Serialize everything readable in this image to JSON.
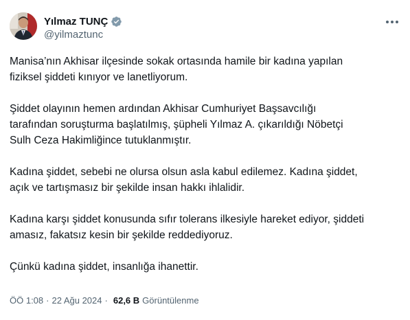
{
  "author": {
    "display_name": "Yılmaz TUNÇ",
    "handle": "@yilmaztunc",
    "verified_icon": "verified-badge-icon",
    "verified_color": "#829aab"
  },
  "tweet": {
    "paragraphs": [
      "Manisa’nın Akhisar ilçesinde sokak ortasında hamile bir kadına yapılan\nfiziksel şiddeti kınıyor ve lanetliyorum.",
      "Şiddet olayının hemen ardından Akhisar Cumhuriyet Başsavcılığı\ntarafından soruşturma başlatılmış, şüpheli Yılmaz A. çıkarıldığı Nöbetçi\nSulh Ceza Hakimliğince tutuklanmıştır.",
      "Kadına şiddet, sebebi ne olursa olsun asla kabul edilemez. Kadına şiddet,\naçık ve tartışmasız bir şekilde insan hakkı ihlalidir.",
      "Kadına karşı şiddet konusunda sıfır tolerans ilkesiyle hareket ediyor, şiddeti\namasız, fakatsız kesin bir şekilde reddediyoruz.",
      "Çünkü kadına şiddet, insanlığa ihanettir."
    ]
  },
  "meta": {
    "time": "ÖÖ 1:08",
    "separator": "·",
    "date": "22 Ağu 2024",
    "views_count": "62,6 B",
    "views_label": "Görüntülenme"
  },
  "colors": {
    "text": "#0f1419",
    "secondary": "#536471"
  },
  "icons": {
    "more": "more-options-icon"
  }
}
